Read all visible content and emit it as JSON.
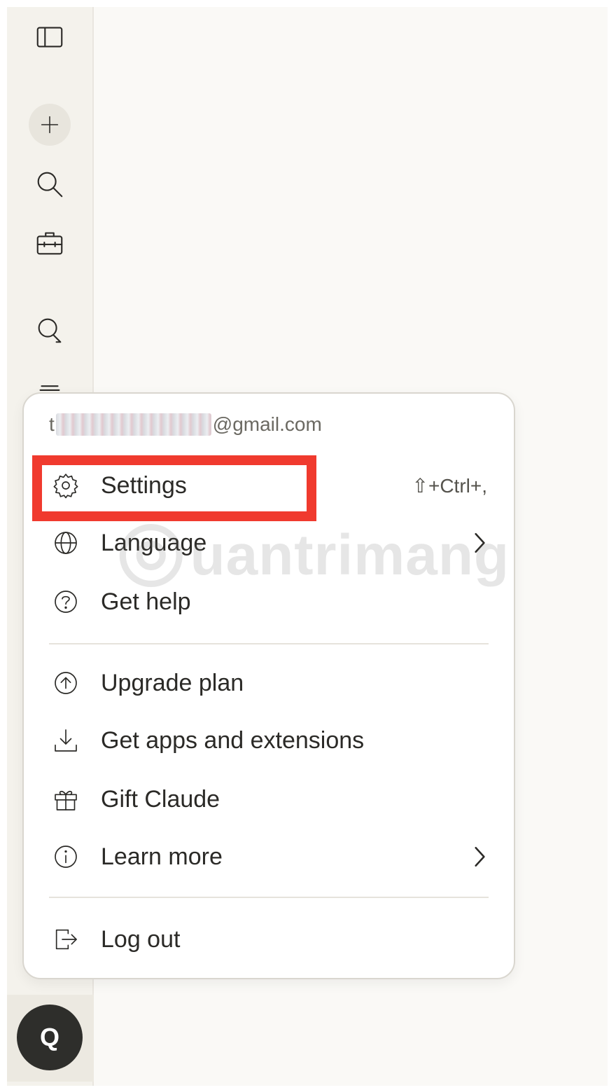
{
  "sidebar": {
    "icons": [
      "sidebar-toggle-icon",
      "plus-icon",
      "search-icon",
      "briefcase-icon",
      "chats-icon",
      "stack-icon"
    ],
    "avatar_initial": "Q"
  },
  "menu": {
    "email_prefix": "t",
    "email_suffix": "@gmail.com",
    "items": [
      {
        "label": "Settings",
        "icon": "gear-icon",
        "shortcut": "⇧+Ctrl+,"
      },
      {
        "label": "Language",
        "icon": "globe-icon",
        "has_submenu": true
      },
      {
        "label": "Get help",
        "icon": "help-icon"
      },
      {
        "label": "Upgrade plan",
        "icon": "arrow-up-circle-icon"
      },
      {
        "label": "Get apps and extensions",
        "icon": "download-icon"
      },
      {
        "label": "Gift Claude",
        "icon": "gift-icon"
      },
      {
        "label": "Learn more",
        "icon": "info-icon",
        "has_submenu": true
      },
      {
        "label": "Log out",
        "icon": "log-out-icon"
      }
    ]
  },
  "watermark": {
    "text": "uantrimang",
    "symbol": "@"
  },
  "colors": {
    "highlight": "#f03a2e",
    "background": "#faf9f6",
    "avatar_bg": "#2e2e2b"
  }
}
